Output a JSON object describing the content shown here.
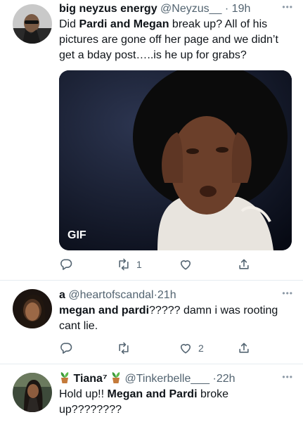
{
  "tweets": [
    {
      "display_name": "big neyzus energy",
      "handle": "@Neyzus__",
      "separator": "·",
      "time": "19h",
      "more": "•••",
      "text_segments": [
        "Did ",
        "Pardi and Megan",
        " break up? All of his pictures are gone off her page and we didn’t get a bday post…..is he up for grabs?"
      ],
      "media_badge": "GIF",
      "actions": {
        "reply_count": "",
        "retweet_count": "1",
        "like_count": ""
      }
    },
    {
      "display_name": "a",
      "handle": "@heartofscandal",
      "separator": "·",
      "time": "21h",
      "more": "•••",
      "text_segments": [
        "megan and pardi",
        "????? damn i was rooting cant lie."
      ],
      "actions": {
        "reply_count": "",
        "retweet_count": "",
        "like_count": "2"
      }
    },
    {
      "display_name": "Tiana⁷",
      "handle": "@Tinkerbelle___",
      "separator": "·",
      "time": "22h",
      "more": "•••",
      "name_icons": [
        "potted-plant-icon",
        "potted-plant-icon"
      ],
      "text_segments": [
        "Hold up!! ",
        "Megan and Pardi",
        " broke up????????"
      ]
    }
  ],
  "icons": {
    "reply": "reply-icon",
    "retweet": "retweet-icon",
    "like": "heart-icon",
    "share": "share-icon"
  },
  "colors": {
    "text": "#0f1419",
    "secondary": "#536471",
    "divider": "#e6ecf0"
  }
}
